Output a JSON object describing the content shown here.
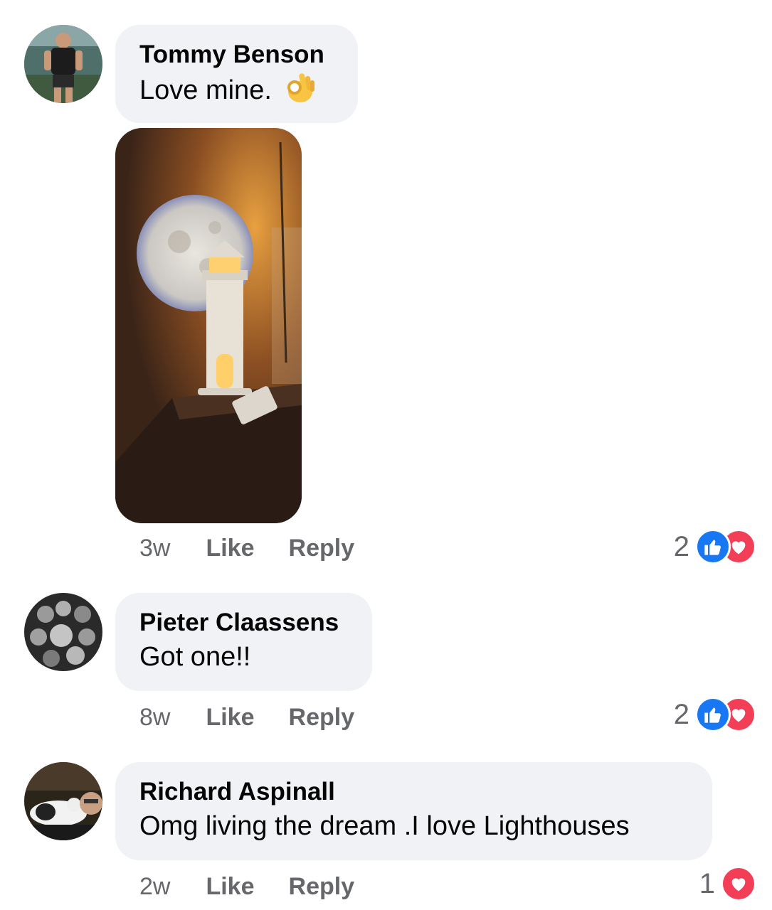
{
  "comments": [
    {
      "author": "Tommy Benson",
      "text": "Love mine.",
      "emoji": "ok-hand-icon",
      "time": "3w",
      "like_label": "Like",
      "reply_label": "Reply",
      "reaction_count": "2",
      "reactions": [
        "like",
        "love"
      ],
      "has_photo": true
    },
    {
      "author": "Pieter Claassens",
      "text": "Got one!!",
      "time": "8w",
      "like_label": "Like",
      "reply_label": "Reply",
      "reaction_count": "2",
      "reactions": [
        "like",
        "love"
      ]
    },
    {
      "author": "Richard Aspinall",
      "text": "Omg living the dream .I love Lighthouses",
      "time": "2w",
      "like_label": "Like",
      "reply_label": "Reply",
      "reaction_count": "1",
      "reactions": [
        "love"
      ]
    }
  ],
  "colors": {
    "bubble": "#f0f2f5",
    "meta_text": "#65676b",
    "like": "#1877f2",
    "love": "#f33e58"
  }
}
